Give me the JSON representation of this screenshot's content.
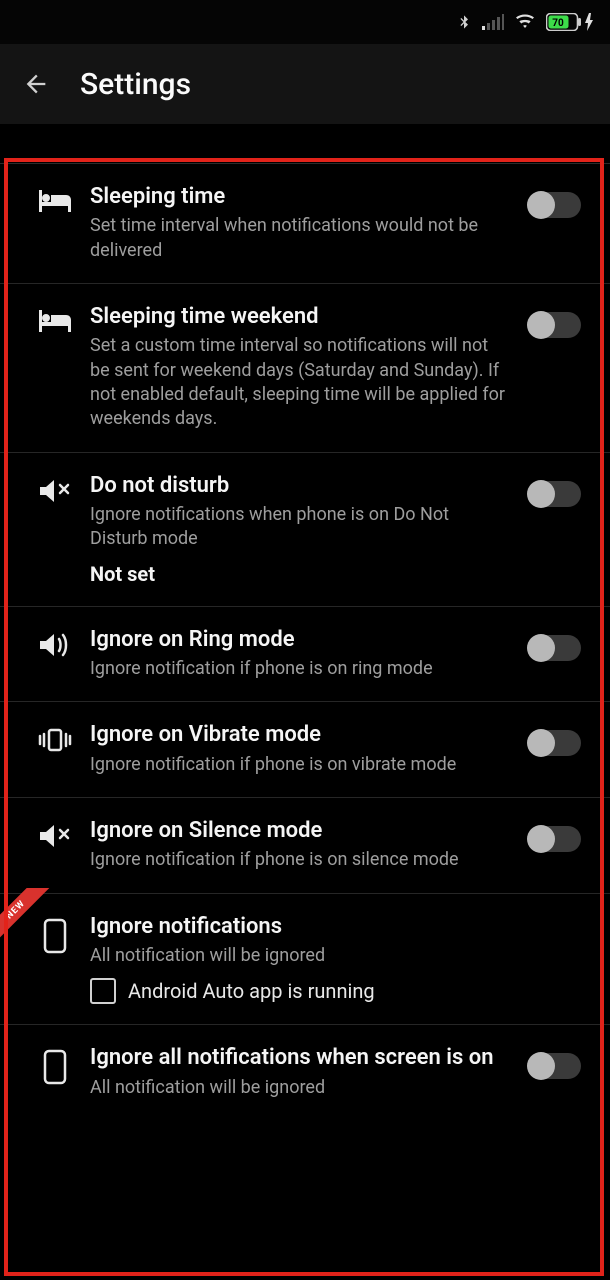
{
  "status": {
    "battery_pct": "70"
  },
  "appbar": {
    "title": "Settings"
  },
  "items": [
    {
      "title": "Sleeping time",
      "desc": "Set time interval when notifications would not be delivered"
    },
    {
      "title": "Sleeping time weekend",
      "desc": "Set a custom time interval so notifications will not be sent for weekend days (Saturday and Sunday). If not enabled default, sleeping time will be applied for weekends days."
    },
    {
      "title": "Do not disturb",
      "desc": "Ignore notifications when phone is on Do Not Disturb mode",
      "extra": "Not set"
    },
    {
      "title": "Ignore on Ring mode",
      "desc": "Ignore notification if phone is on ring mode"
    },
    {
      "title": "Ignore on Vibrate mode",
      "desc": "Ignore notification if phone is on vibrate mode"
    },
    {
      "title": "Ignore on Silence mode",
      "desc": "Ignore notification if phone is on silence mode"
    },
    {
      "title": "Ignore notifications",
      "desc": "All notification will be ignored",
      "checkbox_label": "Android Auto app is running",
      "badge": "NEW"
    },
    {
      "title": "Ignore all notifications when screen is on",
      "desc": "All notification will be ignored"
    }
  ]
}
